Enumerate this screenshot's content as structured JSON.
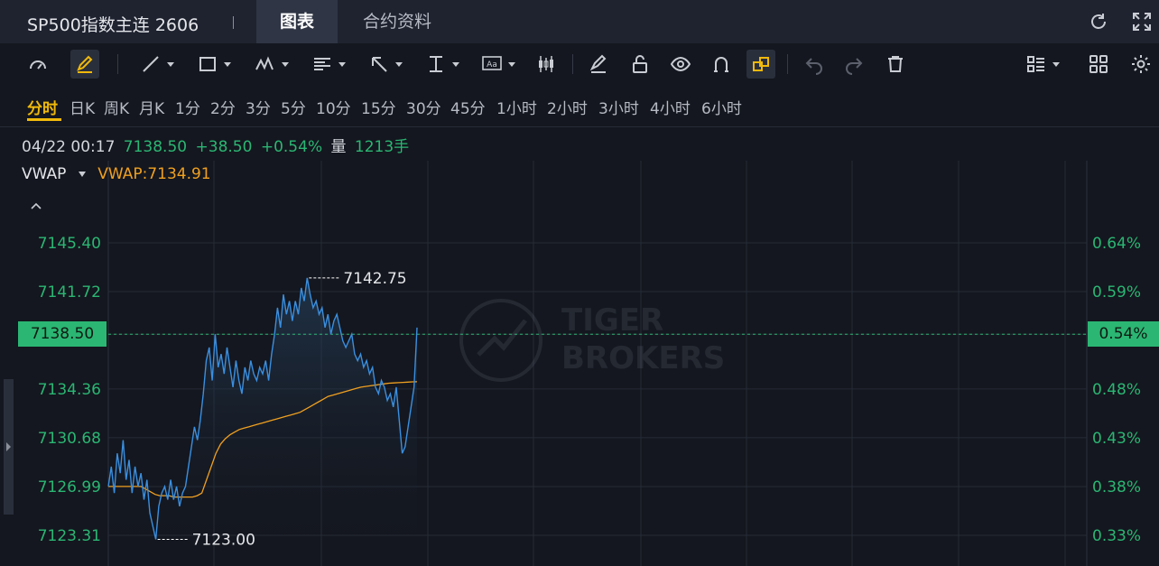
{
  "header": {
    "title": "SP500指数主连 2606",
    "tabs": [
      {
        "label": "图表",
        "active": true
      },
      {
        "label": "合约资料",
        "active": false
      }
    ],
    "icons": [
      "refresh-icon",
      "fullscreen-icon"
    ]
  },
  "toolbar": {
    "tools": [
      "gauge-icon",
      "pencil-highlight-icon",
      "trend-line-icon",
      "rectangle-icon",
      "wave-icon",
      "fibonacci-icon",
      "arrow-icon",
      "measure-icon",
      "text-label-icon",
      "candle-pattern-icon",
      "eraser-icon",
      "lock-icon",
      "eye-icon",
      "magnet-icon",
      "link-icon",
      "undo-icon",
      "redo-icon",
      "delete-icon",
      "list-menu-icon",
      "grid-icon",
      "settings-icon"
    ]
  },
  "periods": [
    "分时",
    "日K",
    "周K",
    "月K",
    "1分",
    "2分",
    "3分",
    "5分",
    "10分",
    "15分",
    "30分",
    "45分",
    "1小时",
    "2小时",
    "3小时",
    "4小时",
    "6小时"
  ],
  "active_period": "分时",
  "quote": {
    "datetime": "04/22 00:17",
    "price": "7138.50",
    "change": "+38.50",
    "change_pct": "+0.54%",
    "volume_label": "量",
    "volume": "1213手"
  },
  "indicator": {
    "name": "VWAP",
    "value_text": "VWAP:7134.91"
  },
  "watermark": {
    "line1": "TIGER",
    "line2": "BROKERS"
  },
  "colors": {
    "up": "#2bb673",
    "price_line": "#3a8fe0",
    "vwap_line": "#f0a020",
    "accent": "#f0b90b",
    "bg": "#14171f"
  },
  "chart_data": {
    "type": "line",
    "y_ticks": [
      "7145.40",
      "7141.72",
      "7138.50",
      "7134.36",
      "7130.68",
      "7126.99",
      "7123.31"
    ],
    "pct_ticks": [
      "0.64%",
      "0.59%",
      "0.54%",
      "0.48%",
      "0.43%",
      "0.38%",
      "0.33%"
    ],
    "ylim": [
      7121.5,
      7149.0
    ],
    "last_price": 7138.5,
    "last_pct": "0.54%",
    "high_label": "7142.75",
    "low_label": "7123.00",
    "high": 7142.75,
    "low": 7123.0,
    "grid": true,
    "series": [
      {
        "name": "",
        "values": [
          7127.0,
          7128.5,
          7126.5,
          7129.5,
          7128.0,
          7130.5,
          7127.5,
          7129.0,
          7126.5,
          7128.5,
          7127.0,
          7128.0,
          7126.0,
          7127.5,
          7125.0,
          7124.0,
          7123.0,
          7125.5,
          7126.5,
          7127.0,
          7126.0,
          7127.5,
          7126.0,
          7127.0,
          7125.5,
          7126.5,
          7127.0,
          7128.5,
          7130.0,
          7131.5,
          7130.5,
          7132.0,
          7134.0,
          7136.5,
          7137.5,
          7135.0,
          7138.5,
          7136.0,
          7137.0,
          7135.5,
          7137.5,
          7136.0,
          7134.5,
          7136.5,
          7135.0,
          7134.0,
          7136.0,
          7135.0,
          7136.5,
          7135.5,
          7135.0,
          7136.0,
          7135.5,
          7136.5,
          7135.0,
          7137.0,
          7138.5,
          7140.5,
          7139.0,
          7141.5,
          7140.0,
          7141.0,
          7139.5,
          7141.0,
          7140.0,
          7142.0,
          7141.0,
          7142.75,
          7141.5,
          7140.5,
          7141.0,
          7140.0,
          7140.5,
          7139.0,
          7140.0,
          7138.5,
          7139.5,
          7140.0,
          7139.0,
          7138.0,
          7137.5,
          7138.0,
          7138.5,
          7137.0,
          7136.5,
          7137.0,
          7136.0,
          7136.5,
          7135.5,
          7136.0,
          7134.5,
          7134.0,
          7135.0,
          7134.5,
          7133.5,
          7134.0,
          7133.0,
          7134.5,
          7132.0,
          7129.5,
          7130.0,
          7131.5,
          7133.0,
          7134.5,
          7139.0
        ]
      },
      {
        "name": "",
        "values": [
          7127.0,
          7127.0,
          7127.0,
          7127.0,
          7127.0,
          7127.0,
          7127.0,
          7127.0,
          7126.8,
          7126.6,
          7126.4,
          7126.3,
          7126.3,
          7126.3,
          7126.2,
          7126.2,
          7126.2,
          7126.2,
          7126.2,
          7126.3,
          7126.5,
          7127.5,
          7128.5,
          7129.5,
          7130.2,
          7130.6,
          7130.9,
          7131.1,
          7131.3,
          7131.4,
          7131.5,
          7131.6,
          7131.7,
          7131.8,
          7131.9,
          7132.0,
          7132.1,
          7132.2,
          7132.3,
          7132.4,
          7132.5,
          7132.6,
          7132.8,
          7133.0,
          7133.2,
          7133.4,
          7133.6,
          7133.8,
          7133.9,
          7134.0,
          7134.1,
          7134.2,
          7134.3,
          7134.4,
          7134.5,
          7134.55,
          7134.6,
          7134.65,
          7134.7,
          7134.75,
          7134.8,
          7134.82,
          7134.84,
          7134.86,
          7134.88,
          7134.9,
          7134.91
        ]
      }
    ]
  }
}
